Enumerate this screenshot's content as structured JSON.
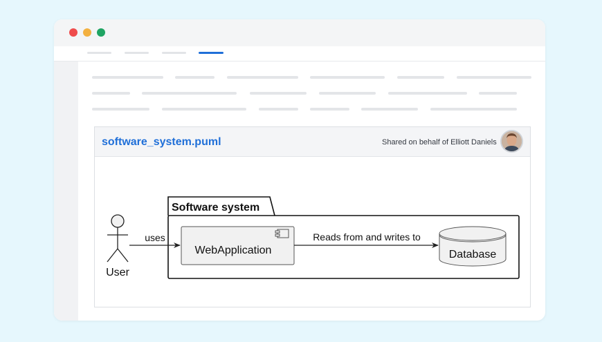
{
  "window": {
    "traffic_lights": [
      "red",
      "yellow",
      "green"
    ],
    "colors": {
      "close": "#ef4c4c",
      "minimize": "#f3b141",
      "zoom": "#1fa463",
      "accent": "#1f6fd8"
    }
  },
  "card": {
    "file_name": "software_system.puml",
    "shared_text": "Shared on behalf of Elliott Daniels"
  },
  "diagram": {
    "actor": {
      "label": "User"
    },
    "package": {
      "label": "Software system"
    },
    "component": {
      "label": "WebApplication",
      "icon": "component-icon"
    },
    "database": {
      "label": "Database"
    },
    "edges": [
      {
        "from": "User",
        "to": "WebApplication",
        "label": "uses"
      },
      {
        "from": "WebApplication",
        "to": "Database",
        "label": "Reads from and writes to"
      }
    ]
  }
}
